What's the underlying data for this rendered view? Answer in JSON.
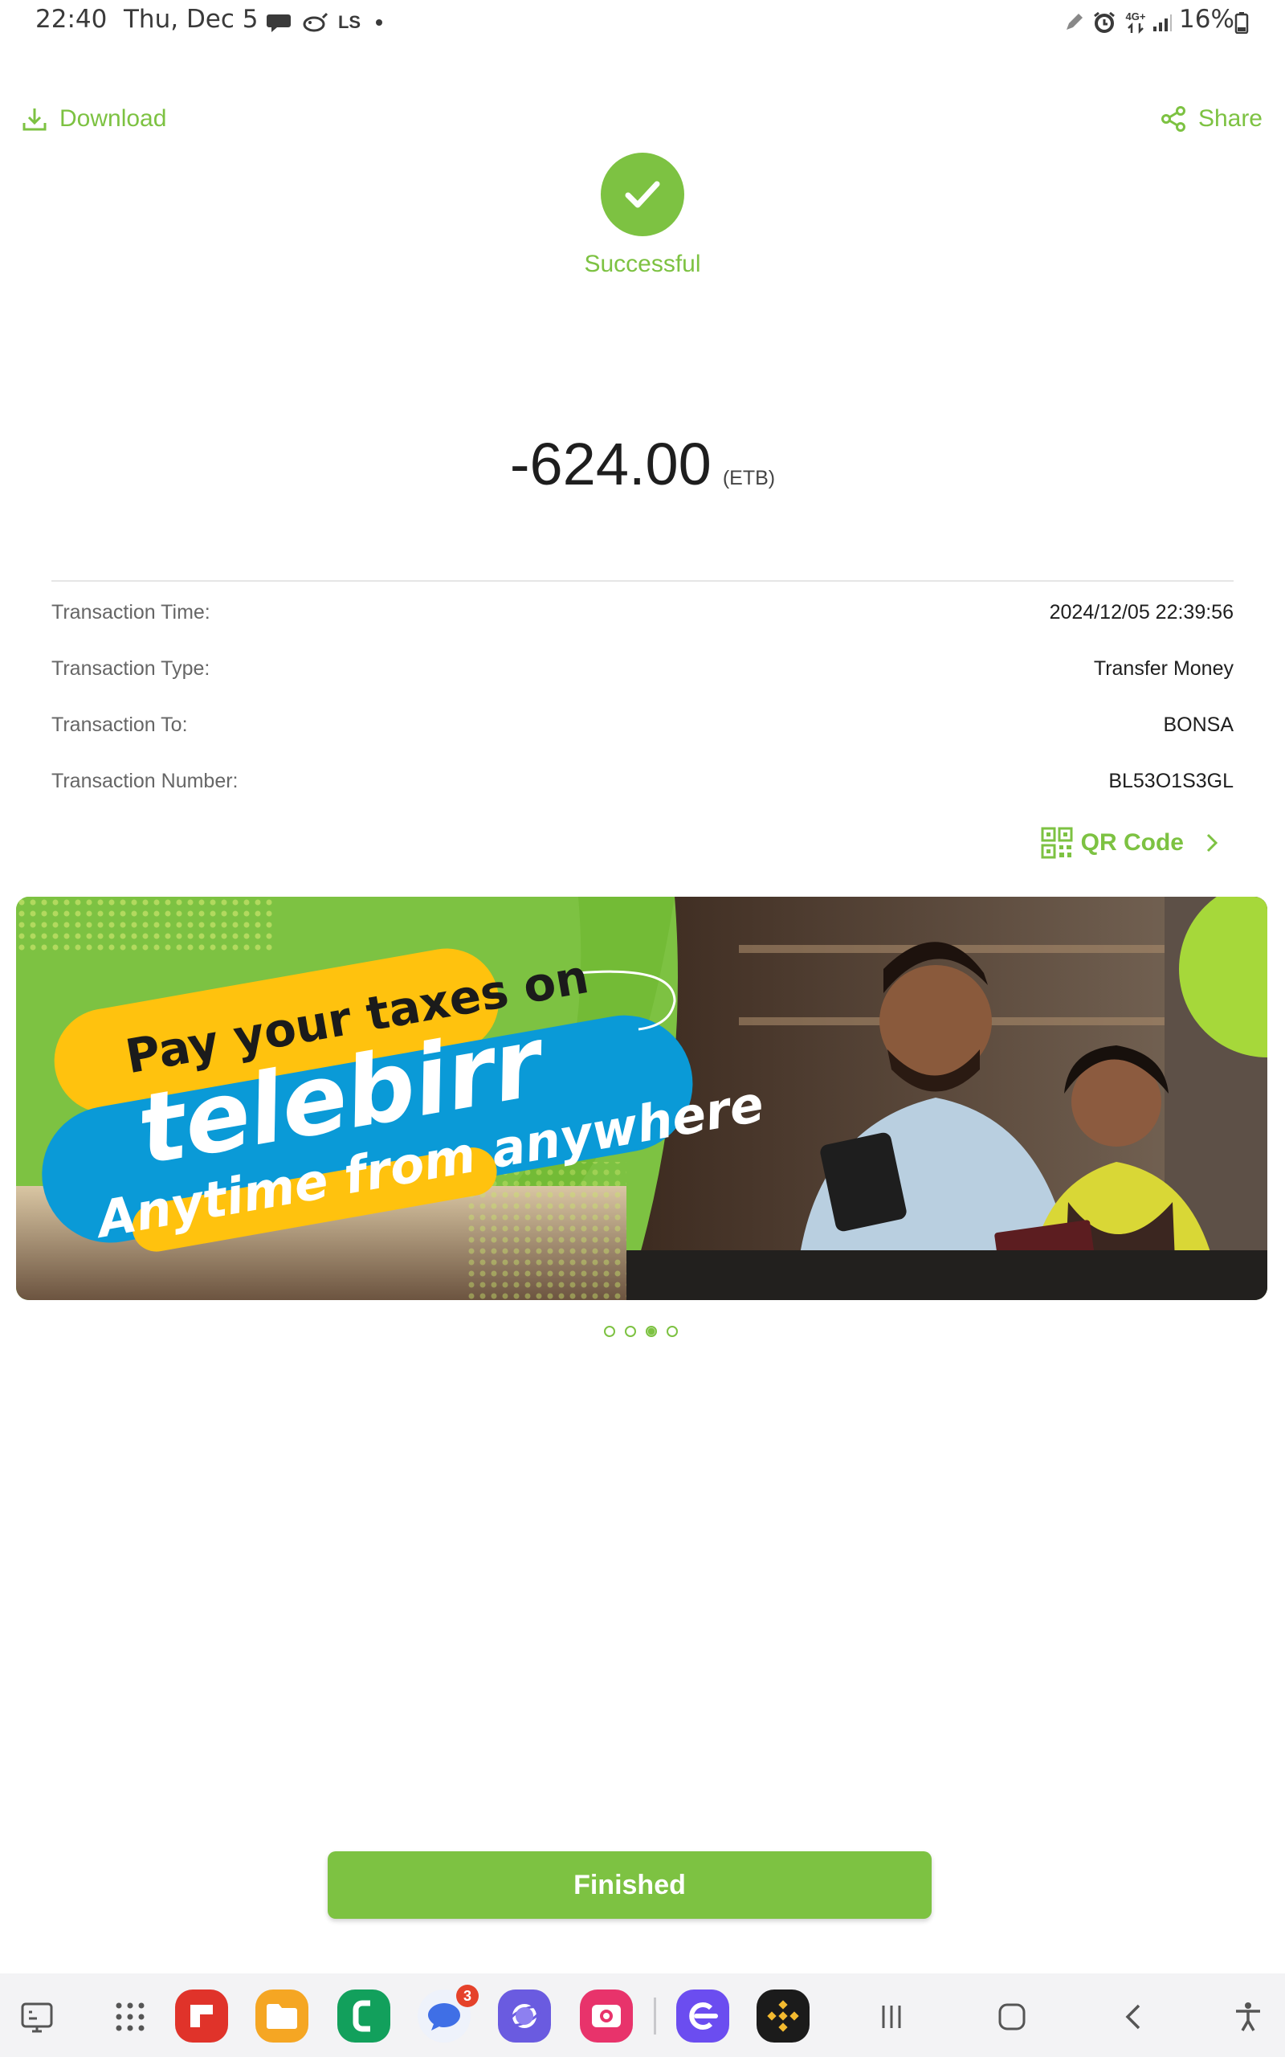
{
  "status_bar": {
    "time": "22:40",
    "date": "Thu, Dec 5",
    "battery": "16%",
    "network": "4G+",
    "notification_icons": [
      "chat-bubble-icon",
      "bird-icon",
      "ls-icon",
      "dot-icon"
    ],
    "system_icons": [
      "pen-icon",
      "alarm-icon",
      "network-4g-icon",
      "signal-icon",
      "battery-icon"
    ]
  },
  "top_bar": {
    "download_label": "Download",
    "share_label": "Share"
  },
  "status": {
    "label": "Successful",
    "icon": "checkmark-icon"
  },
  "amount": {
    "value": "-624.00",
    "currency": "(ETB)"
  },
  "details": [
    {
      "label": "Transaction Time:",
      "value": "2024/12/05 22:39:56"
    },
    {
      "label": "Transaction Type:",
      "value": "Transfer Money"
    },
    {
      "label": "Transaction To:",
      "value": "BONSA"
    },
    {
      "label": "Transaction Number:",
      "value": "BL53O1S3GL"
    }
  ],
  "qr": {
    "label": "QR Code"
  },
  "banner": {
    "line1": "Pay your taxes on",
    "brand": "telebirr",
    "line3": "Anytime from anywhere"
  },
  "carousel": {
    "total": 4,
    "active_index": 2
  },
  "finish_button": {
    "label": "Finished"
  },
  "dock": {
    "messages_badge": "3",
    "apps": [
      "taskbar-toggle-icon",
      "app-grid-icon",
      "flipboard-icon",
      "my-files-icon",
      "phone-icon",
      "messages-icon",
      "internet-icon",
      "screen-recorder-icon",
      "samsung-browser-icon",
      "binance-icon"
    ],
    "nav": [
      "recent-apps-icon",
      "home-icon",
      "back-icon",
      "accessibility-icon"
    ]
  },
  "colors": {
    "accent": "#7dc242",
    "banner_yellow": "#ffc20e",
    "banner_blue": "#0a9ad7",
    "badge_red": "#e5422b"
  }
}
